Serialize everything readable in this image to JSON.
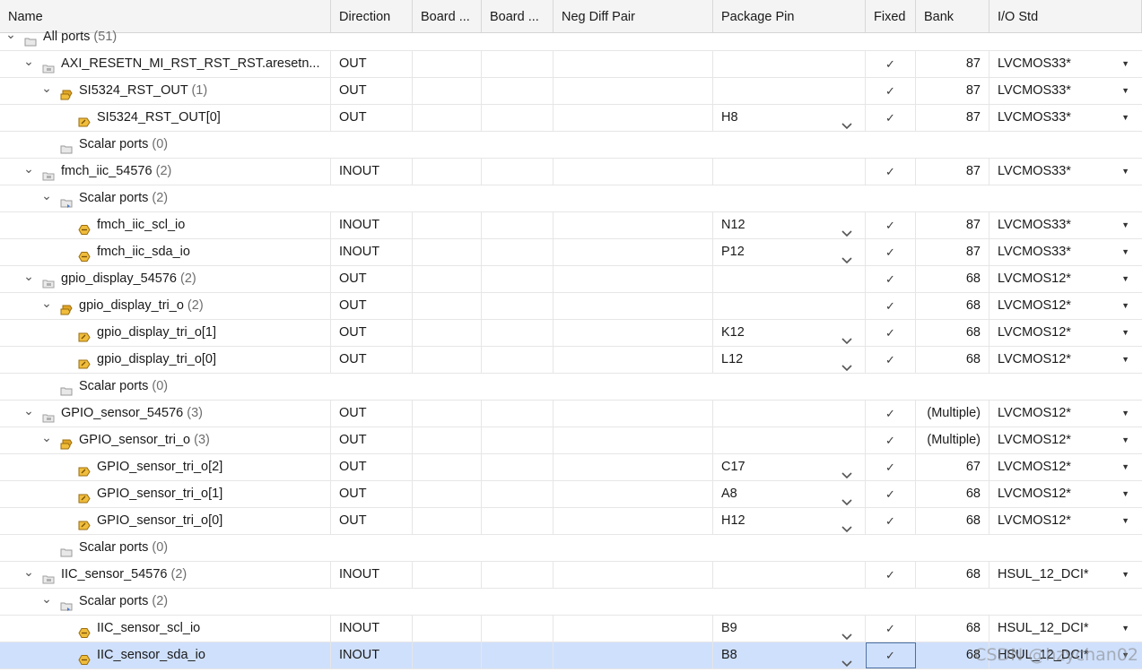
{
  "columns": {
    "name": "Name",
    "direction": "Direction",
    "board1": "Board ...",
    "board2": "Board ...",
    "neg_diff_pair": "Neg Diff Pair",
    "package_pin": "Package Pin",
    "fixed": "Fixed",
    "bank": "Bank",
    "io_std": "I/O Std"
  },
  "rows": [
    {
      "level": 0,
      "expand": "open",
      "icon": "folder-icon",
      "name": "All ports",
      "count": "(51)",
      "kind": "group"
    },
    {
      "level": 1,
      "expand": "open",
      "icon": "interface-icon",
      "name": "AXI_RESETN_MI_RST_RST_RST.aresetn...",
      "count": "",
      "direction": "OUT",
      "pin": "",
      "fixed": "✓",
      "bank": "87",
      "iostd": "LVCMOS33*",
      "kind": "port"
    },
    {
      "level": 2,
      "expand": "open",
      "icon": "bus-port-icon",
      "name": "SI5324_RST_OUT",
      "count": "(1)",
      "direction": "OUT",
      "pin": "",
      "fixed": "✓",
      "bank": "87",
      "iostd": "LVCMOS33*",
      "kind": "port"
    },
    {
      "level": 3,
      "expand": "none",
      "icon": "output-port-icon",
      "name": "SI5324_RST_OUT[0]",
      "count": "",
      "direction": "OUT",
      "pin": "H8",
      "fixed": "✓",
      "bank": "87",
      "iostd": "LVCMOS33*",
      "kind": "port",
      "pin_dropdown": true
    },
    {
      "level": 2,
      "expand": "none",
      "icon": "folder-icon",
      "name": "Scalar ports",
      "count": "(0)",
      "kind": "group"
    },
    {
      "level": 1,
      "expand": "open",
      "icon": "interface-icon",
      "name": "fmch_iic_54576",
      "count": "(2)",
      "direction": "INOUT",
      "pin": "",
      "fixed": "✓",
      "bank": "87",
      "iostd": "LVCMOS33*",
      "kind": "port"
    },
    {
      "level": 2,
      "expand": "open",
      "icon": "scalar-folder-icon",
      "name": "Scalar ports",
      "count": "(2)",
      "kind": "group"
    },
    {
      "level": 3,
      "expand": "none",
      "icon": "inout-port-icon",
      "name": "fmch_iic_scl_io",
      "count": "",
      "direction": "INOUT",
      "pin": "N12",
      "fixed": "✓",
      "bank": "87",
      "iostd": "LVCMOS33*",
      "kind": "port",
      "pin_dropdown": true
    },
    {
      "level": 3,
      "expand": "none",
      "icon": "inout-port-icon",
      "name": "fmch_iic_sda_io",
      "count": "",
      "direction": "INOUT",
      "pin": "P12",
      "fixed": "✓",
      "bank": "87",
      "iostd": "LVCMOS33*",
      "kind": "port",
      "pin_dropdown": true
    },
    {
      "level": 1,
      "expand": "open",
      "icon": "interface-icon",
      "name": "gpio_display_54576",
      "count": "(2)",
      "direction": "OUT",
      "pin": "",
      "fixed": "✓",
      "bank": "68",
      "iostd": "LVCMOS12*",
      "kind": "port"
    },
    {
      "level": 2,
      "expand": "open",
      "icon": "bus-port-icon",
      "name": "gpio_display_tri_o",
      "count": "(2)",
      "direction": "OUT",
      "pin": "",
      "fixed": "✓",
      "bank": "68",
      "iostd": "LVCMOS12*",
      "kind": "port"
    },
    {
      "level": 3,
      "expand": "none",
      "icon": "output-port-icon",
      "name": "gpio_display_tri_o[1]",
      "count": "",
      "direction": "OUT",
      "pin": "K12",
      "fixed": "✓",
      "bank": "68",
      "iostd": "LVCMOS12*",
      "kind": "port",
      "pin_dropdown": true
    },
    {
      "level": 3,
      "expand": "none",
      "icon": "output-port-icon",
      "name": "gpio_display_tri_o[0]",
      "count": "",
      "direction": "OUT",
      "pin": "L12",
      "fixed": "✓",
      "bank": "68",
      "iostd": "LVCMOS12*",
      "kind": "port",
      "pin_dropdown": true
    },
    {
      "level": 2,
      "expand": "none",
      "icon": "folder-icon",
      "name": "Scalar ports",
      "count": "(0)",
      "kind": "group"
    },
    {
      "level": 1,
      "expand": "open",
      "icon": "interface-icon",
      "name": "GPIO_sensor_54576",
      "count": "(3)",
      "direction": "OUT",
      "pin": "",
      "fixed": "✓",
      "bank": "(Multiple)",
      "iostd": "LVCMOS12*",
      "kind": "port"
    },
    {
      "level": 2,
      "expand": "open",
      "icon": "bus-port-icon",
      "name": "GPIO_sensor_tri_o",
      "count": "(3)",
      "direction": "OUT",
      "pin": "",
      "fixed": "✓",
      "bank": "(Multiple)",
      "iostd": "LVCMOS12*",
      "kind": "port"
    },
    {
      "level": 3,
      "expand": "none",
      "icon": "output-port-icon",
      "name": "GPIO_sensor_tri_o[2]",
      "count": "",
      "direction": "OUT",
      "pin": "C17",
      "fixed": "✓",
      "bank": "67",
      "iostd": "LVCMOS12*",
      "kind": "port",
      "pin_dropdown": true
    },
    {
      "level": 3,
      "expand": "none",
      "icon": "output-port-icon",
      "name": "GPIO_sensor_tri_o[1]",
      "count": "",
      "direction": "OUT",
      "pin": "A8",
      "fixed": "✓",
      "bank": "68",
      "iostd": "LVCMOS12*",
      "kind": "port",
      "pin_dropdown": true
    },
    {
      "level": 3,
      "expand": "none",
      "icon": "output-port-icon",
      "name": "GPIO_sensor_tri_o[0]",
      "count": "",
      "direction": "OUT",
      "pin": "H12",
      "fixed": "✓",
      "bank": "68",
      "iostd": "LVCMOS12*",
      "kind": "port",
      "pin_dropdown": true
    },
    {
      "level": 2,
      "expand": "none",
      "icon": "folder-icon",
      "name": "Scalar ports",
      "count": "(0)",
      "kind": "group"
    },
    {
      "level": 1,
      "expand": "open",
      "icon": "interface-icon",
      "name": "IIC_sensor_54576",
      "count": "(2)",
      "direction": "INOUT",
      "pin": "",
      "fixed": "✓",
      "bank": "68",
      "iostd": "HSUL_12_DCI*",
      "kind": "port"
    },
    {
      "level": 2,
      "expand": "open",
      "icon": "scalar-folder-icon",
      "name": "Scalar ports",
      "count": "(2)",
      "kind": "group"
    },
    {
      "level": 3,
      "expand": "none",
      "icon": "inout-port-icon",
      "name": "IIC_sensor_scl_io",
      "count": "",
      "direction": "INOUT",
      "pin": "B9",
      "fixed": "✓",
      "bank": "68",
      "iostd": "HSUL_12_DCI*",
      "kind": "port",
      "pin_dropdown": true
    },
    {
      "level": 3,
      "expand": "none",
      "icon": "inout-port-icon",
      "name": "IIC_sensor_sda_io",
      "count": "",
      "direction": "INOUT",
      "pin": "B8",
      "fixed": "✓",
      "bank": "68",
      "iostd": "HSUL_12_DCI*",
      "kind": "port",
      "pin_dropdown": true,
      "selected": true
    }
  ],
  "watermark": "CSDN @hzychan02",
  "colors": {
    "selected_row": "#cfe0fc",
    "port_icon": "#d9a520",
    "header_bg": "#f4f4f4"
  }
}
